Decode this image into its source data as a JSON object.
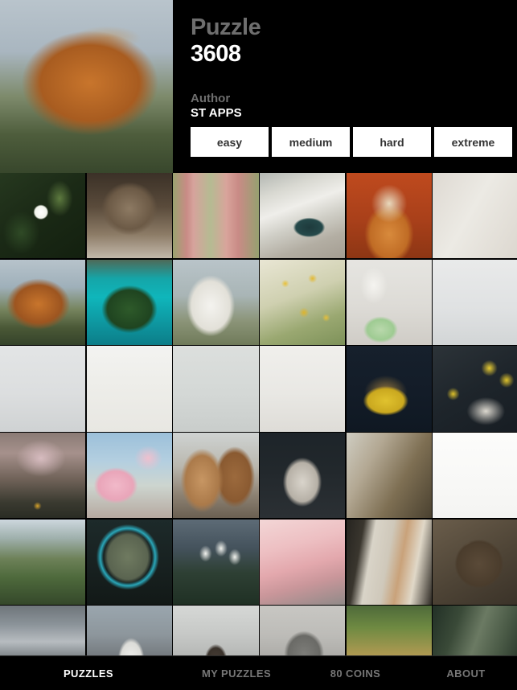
{
  "header": {
    "puzzle_label": "Puzzle",
    "puzzle_number": "3608",
    "author_label": "Author",
    "author_name": "ST APPS",
    "difficulties": [
      {
        "label": "easy"
      },
      {
        "label": "medium"
      },
      {
        "label": "hard"
      },
      {
        "label": "extreme"
      }
    ]
  },
  "hero": {
    "name": "highland-cow"
  },
  "grid": {
    "columns": 6,
    "thumbnails": [
      {
        "name": "white-jasmine-flower",
        "style": "ph-jasmine"
      },
      {
        "name": "persian-cat",
        "style": "ph-cat"
      },
      {
        "name": "pink-bridge-greenhouse",
        "style": "ph-bridge"
      },
      {
        "name": "truck-on-beach-wave",
        "style": "ph-beach"
      },
      {
        "name": "corgi-dog",
        "style": "ph-corgi"
      },
      {
        "name": "toast-flatlay",
        "style": "ph-toast"
      },
      {
        "name": "highland-cow-grazing",
        "style": "ph-cow2"
      },
      {
        "name": "turquoise-lake-island",
        "style": "ph-lake"
      },
      {
        "name": "white-llama",
        "style": "ph-llama"
      },
      {
        "name": "yellow-mimosa-blossom",
        "style": "ph-mimosa"
      },
      {
        "name": "macarons-white-jug",
        "style": "ph-macaron"
      },
      {
        "name": "green-smoothie-bottle",
        "style": "ph-smoothie"
      },
      {
        "name": "honey-dipper-strawberries",
        "style": "ph-honey"
      },
      {
        "name": "pancake-stack-blueberries",
        "style": "ph-pancake"
      },
      {
        "name": "macaron-plates-topview",
        "style": "ph-plates"
      },
      {
        "name": "ice-cream-cone",
        "style": "ph-cone"
      },
      {
        "name": "lemon-basket",
        "style": "ph-lemonbasket"
      },
      {
        "name": "lemons-on-slate",
        "style": "ph-lemons"
      },
      {
        "name": "forest-path-hiker",
        "style": "ph-forest"
      },
      {
        "name": "cherry-blossom-city",
        "style": "ph-blossom"
      },
      {
        "name": "icelandic-horses",
        "style": "ph-horse"
      },
      {
        "name": "grey-kitten",
        "style": "ph-kitten"
      },
      {
        "name": "abandoned-greenhouse",
        "style": "ph-greenhouse"
      },
      {
        "name": "pink-blossom-branch",
        "style": "ph-pinkbranch"
      },
      {
        "name": "green-mountain-valley",
        "style": "ph-valley"
      },
      {
        "name": "turquoise-platter-food",
        "style": "ph-platter"
      },
      {
        "name": "white-tulips",
        "style": "ph-tulip"
      },
      {
        "name": "pink-snowy-mountain",
        "style": "ph-pinkmount"
      },
      {
        "name": "art-prints-stall",
        "style": "ph-prints"
      },
      {
        "name": "spices-wooden-tray",
        "style": "ph-spice"
      },
      {
        "name": "stadium-aerial",
        "style": "ph-stadium"
      },
      {
        "name": "white-pitbull",
        "style": "ph-pitbull"
      },
      {
        "name": "dog-in-window",
        "style": "ph-dogwin"
      },
      {
        "name": "foggy-rock-mountain",
        "style": "ph-fogmount"
      },
      {
        "name": "cheetah-in-grass",
        "style": "ph-cheetah"
      },
      {
        "name": "dark-green-wall",
        "style": "ph-greenwall"
      }
    ]
  },
  "nav": {
    "items": [
      {
        "label": "PUZZLES",
        "active": true
      },
      {
        "label": "MY PUZZLES",
        "active": false
      },
      {
        "label": "80 COINS",
        "active": false
      },
      {
        "label": "ABOUT",
        "active": false
      }
    ]
  }
}
